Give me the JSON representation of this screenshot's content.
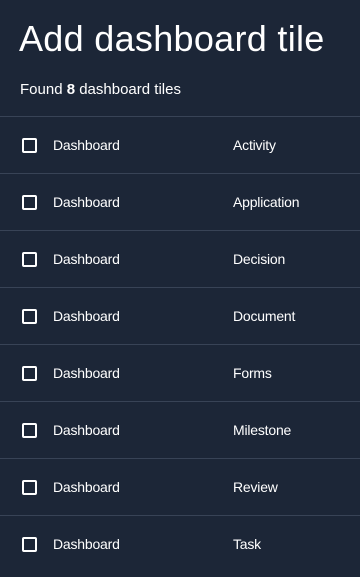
{
  "title": "Add dashboard tile",
  "summary": {
    "prefix": "Found ",
    "count": "8",
    "suffix": " dashboard tiles"
  },
  "tiles": [
    {
      "name": "Dashboard",
      "type": "Activity"
    },
    {
      "name": "Dashboard",
      "type": "Application"
    },
    {
      "name": "Dashboard",
      "type": "Decision"
    },
    {
      "name": "Dashboard",
      "type": "Document"
    },
    {
      "name": "Dashboard",
      "type": "Forms"
    },
    {
      "name": "Dashboard",
      "type": "Milestone"
    },
    {
      "name": "Dashboard",
      "type": "Review"
    },
    {
      "name": "Dashboard",
      "type": "Task"
    }
  ]
}
